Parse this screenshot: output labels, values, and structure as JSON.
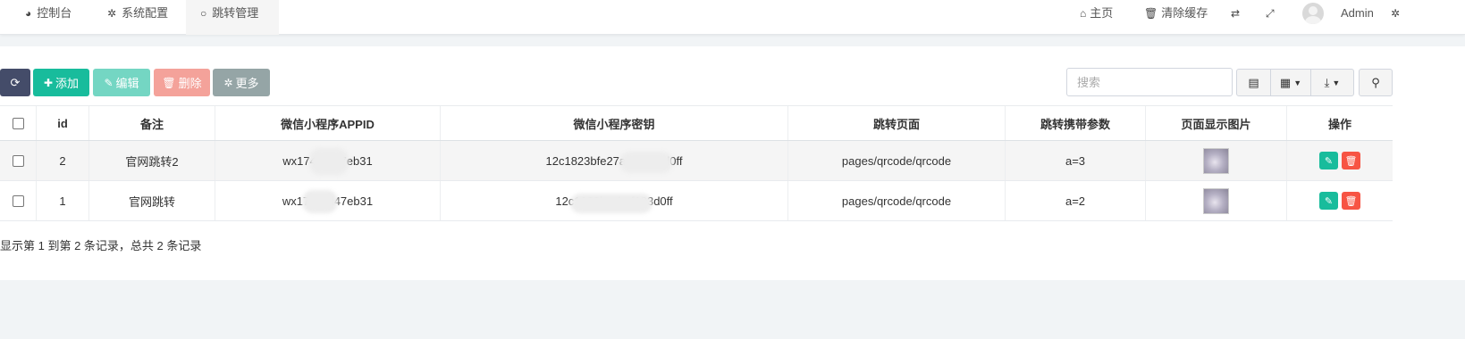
{
  "nav": {
    "tabs": [
      {
        "icon": "dashboard-icon",
        "glyph": "◕",
        "label": "控制台"
      },
      {
        "icon": "gear-icon",
        "glyph": "✲",
        "label": "系统配置"
      },
      {
        "icon": "circle-icon",
        "glyph": "○",
        "label": "跳转管理"
      }
    ],
    "right": {
      "home": "主页",
      "clear_cache": "清除缓存",
      "user": "Admin"
    }
  },
  "toolbar": {
    "add": "添加",
    "edit": "编辑",
    "delete": "删除",
    "more": "更多",
    "search_placeholder": "搜索"
  },
  "table": {
    "columns": [
      "id",
      "备注",
      "微信小程序APPID",
      "微信小程序密钥",
      "跳转页面",
      "跳转携带参数",
      "页面显示图片",
      "操作"
    ],
    "rows": [
      {
        "id": "2",
        "note": "官网跳转2",
        "appid": "wx174c···47eb31",
        "secret": "12c1823bfe27a0···103d0ff",
        "page": "pages/qrcode/qrcode",
        "param": "a=3"
      },
      {
        "id": "1",
        "note": "官网跳转",
        "appid": "wx174···d47eb31",
        "secret": "12c1823b···bef103d0ff",
        "page": "pages/qrcode/qrcode",
        "param": "a=2"
      }
    ]
  },
  "footer": {
    "page_info": "显示第 1 到第 2 条记录，总共 2 条记录"
  },
  "colors": {
    "add": "#18bc9c",
    "edit": "#74d6c3",
    "delete": "#f4a29a",
    "more": "#95a5a6",
    "refresh": "#444c69",
    "op_delete": "#f75444"
  }
}
